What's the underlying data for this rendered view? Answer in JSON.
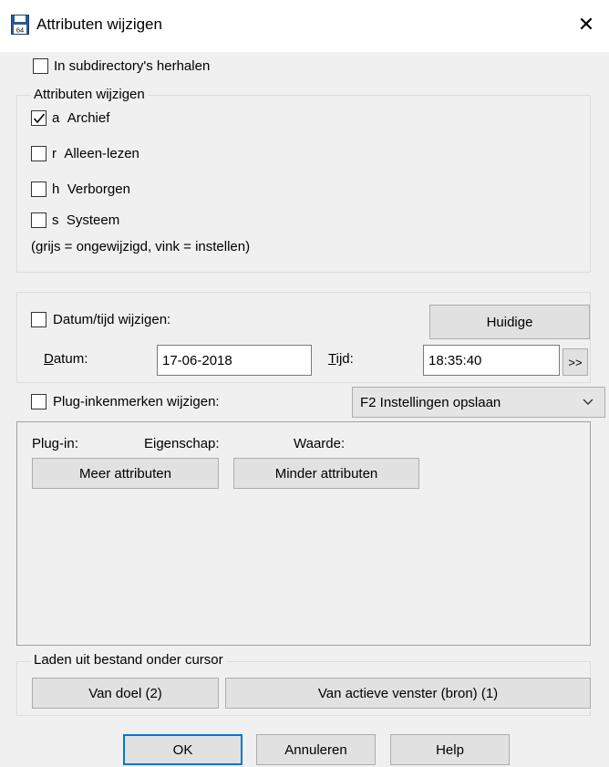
{
  "window": {
    "title": "Attributen wijzigen",
    "close_symbol": "✕",
    "icon": "floppy-disk-icon",
    "icon_badge": "64"
  },
  "recurse": {
    "label": "In subdirectory's herhalen",
    "checked": false
  },
  "attributes": {
    "group_label": "Attributen wijzigen",
    "items": [
      {
        "letter": "a",
        "label": "Archief",
        "checked": true
      },
      {
        "letter": "r",
        "label": "Alleen-lezen",
        "checked": false
      },
      {
        "letter": "h",
        "label": "Verborgen",
        "checked": false
      },
      {
        "letter": "s",
        "label": "Systeem",
        "checked": false
      }
    ],
    "hint": "(grijs = ongewijzigd, vink = instellen)"
  },
  "datetime": {
    "checkbox_label": "Datum/tijd wijzigen:",
    "current_button": "Huidige",
    "date_label_u": "D",
    "date_label_rest": "atum:",
    "date_value": "17-06-2018",
    "time_label_u": "T",
    "time_label_rest": "ijd:",
    "time_value": "18:35:40",
    "more_button": ">>"
  },
  "plugin": {
    "checkbox_label": "Plug-inkenmerken wijzigen:",
    "dropdown_value": "F2 Instellingen opslaan",
    "col_plugin": "Plug-in:",
    "col_property": "Eigenschap:",
    "col_value": "Waarde:",
    "more_attrs": "Meer attributen",
    "less_attrs": "Minder attributen"
  },
  "load": {
    "group_label": "Laden uit bestand onder cursor",
    "from_target": "Van doel (2)",
    "from_active": "Van actieve venster (bron) (1)"
  },
  "footer": {
    "ok": "OK",
    "cancel": "Annuleren",
    "help": "Help"
  },
  "colors": {
    "accent": "#0078d7",
    "background": "#f0f0f0",
    "check": "#000000"
  }
}
